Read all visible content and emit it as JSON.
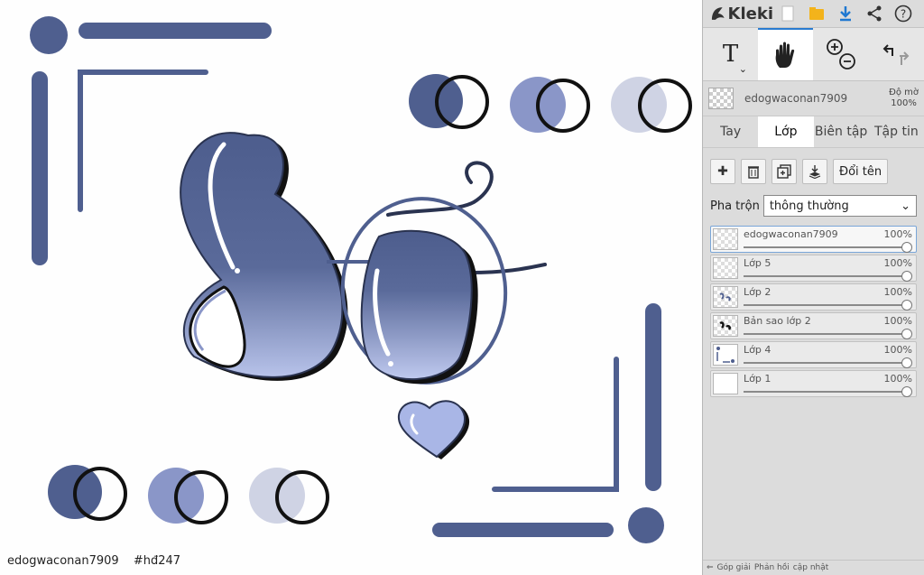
{
  "caption": {
    "username": "edogwaconan7909",
    "tag": "#hđ247"
  },
  "panel": {
    "app_name": "Kleki",
    "icons": [
      "new-file-icon",
      "folder-icon",
      "download-icon",
      "share-icon",
      "help-icon"
    ],
    "tools": {
      "text_tool": "T"
    },
    "current_layer": {
      "name": "edogwaconan7909",
      "opacity_label": "Độ mờ",
      "opacity_value": "100%"
    },
    "tabs": [
      {
        "label": "Tay"
      },
      {
        "label": "Lớp"
      },
      {
        "label": "Biên tập"
      },
      {
        "label": "Tập tin"
      }
    ],
    "rename_label": "Đổi tên",
    "blend_label": "Pha trộn",
    "blend_value": "thông thường",
    "layers": [
      {
        "name": "edogwaconan7909",
        "opacity": "100%"
      },
      {
        "name": "Lớp 5",
        "opacity": "100%"
      },
      {
        "name": "Lớp 2",
        "opacity": "100%"
      },
      {
        "name": "Bản sao lớp 2",
        "opacity": "100%"
      },
      {
        "name": "Lớp 4",
        "opacity": "100%"
      },
      {
        "name": "Lớp 1",
        "opacity": "100%"
      }
    ],
    "bottom": {
      "left_label": "Góp giải",
      "mid_label": "Phản hồi",
      "right_label": "cập nhật"
    }
  },
  "colors": {
    "dark": "#4f5f8f",
    "mid": "#8a96c8",
    "light": "#cfd3e4",
    "accent": "#2a7bd0"
  }
}
